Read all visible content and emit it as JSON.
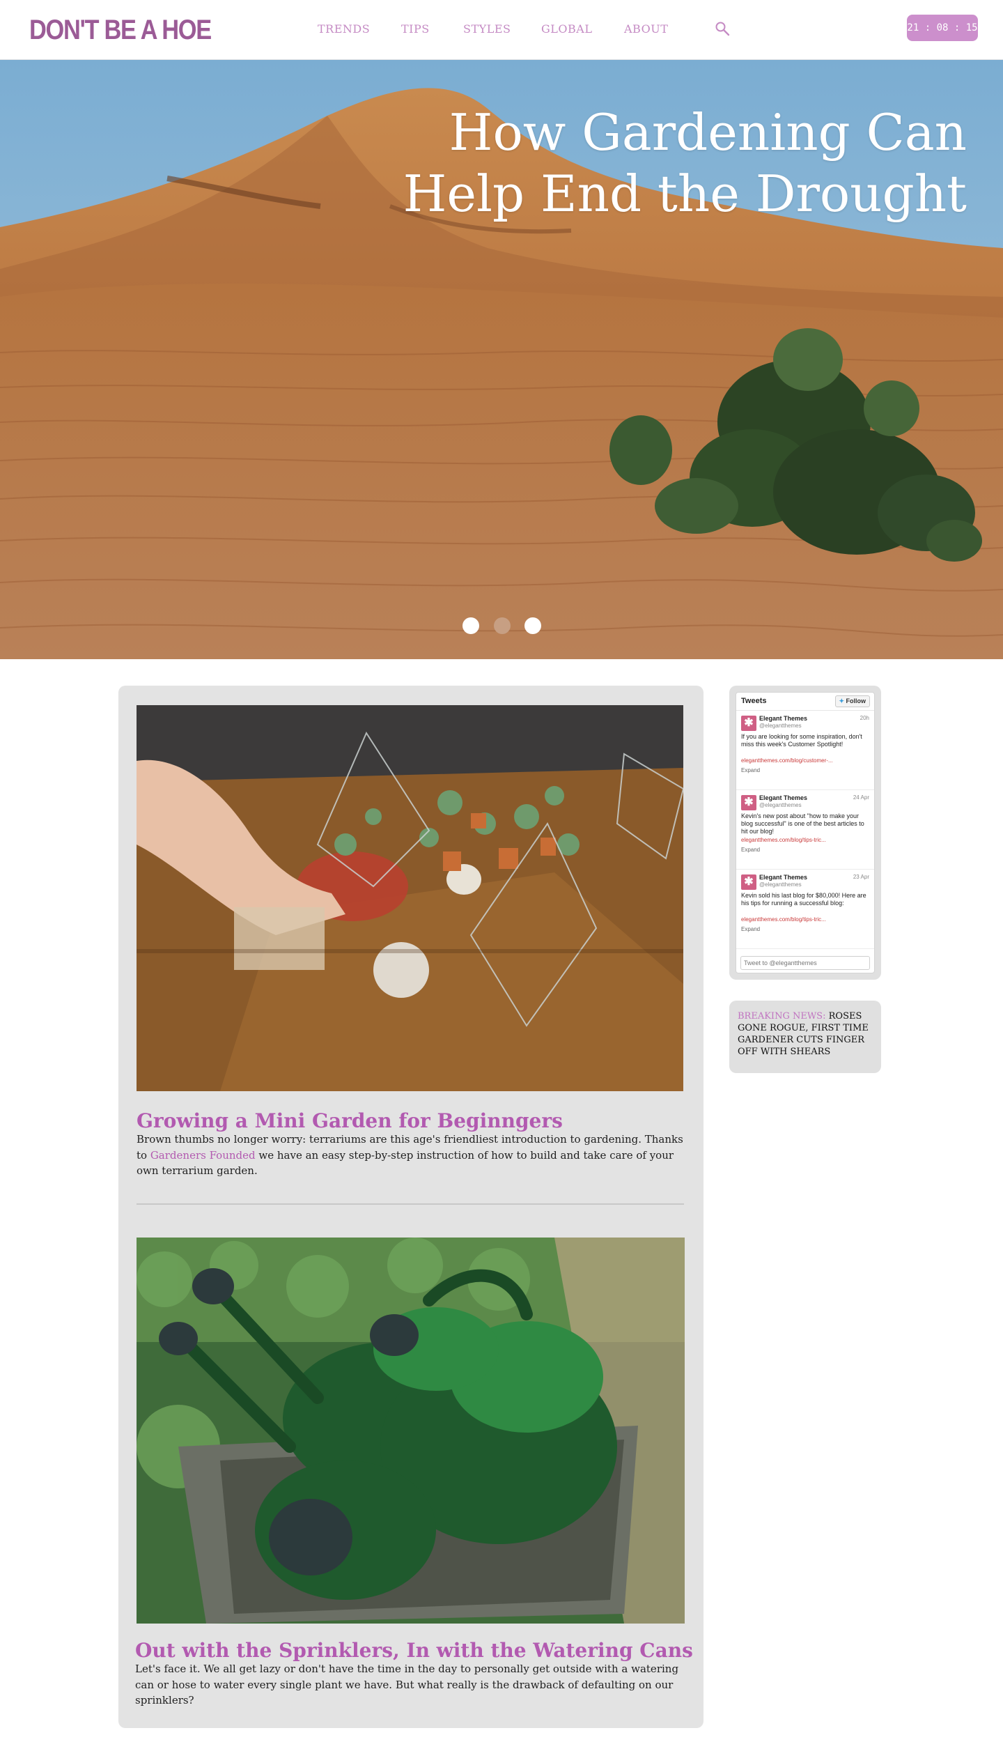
{
  "header": {
    "logo": "DON'T BE A HOE",
    "nav": [
      "TRENDS",
      "TIPS",
      "STYLES",
      "GLOBAL",
      "ABOUT"
    ],
    "clock": "21 : 08 : 15"
  },
  "hero": {
    "title_line1": "How Gardening Can",
    "title_line2": "Help End the Drought",
    "slides_total": 3,
    "active_slide": 2
  },
  "posts": [
    {
      "title": "Growing a Mini Garden for Beginngers",
      "excerpt_before": "Brown thumbs no longer worry: terrariums are this age's friendliest introduction to gardening. Thanks to ",
      "link_text": "Gardeners Founded",
      "excerpt_after": " we have an easy step-by-step instruction of how to build and take care of your own terrarium garden."
    },
    {
      "title": "Out with the Sprinklers, In with the Watering Cans",
      "excerpt": "Let's face it. We all get lazy or don't have the time in the day to personally get outside with a watering can or hose to water every single plant we have. But what really is the drawback of defaulting on our sprinklers?"
    }
  ],
  "sidebar": {
    "tweets": {
      "title": "Tweets",
      "follow_label": "Follow",
      "items": [
        {
          "name": "Elegant Themes",
          "handle": "@elegantthemes",
          "time": "20h",
          "text": "If you are looking for some inspiration, don't miss this week's Customer Spotlight!",
          "link": "elegantthemes.com/blog/customer-...",
          "expand": "Expand"
        },
        {
          "name": "Elegant Themes",
          "handle": "@elegantthemes",
          "time": "24 Apr",
          "text": "Kevin's new post about \"how to make your blog successful\" is one of the best articles to hit our blog!",
          "link": "elegantthemes.com/blog/tips-tric...",
          "expand": "Expand"
        },
        {
          "name": "Elegant Themes",
          "handle": "@elegantthemes",
          "time": "23 Apr",
          "text": "Kevin sold his last blog for $80,000! Here are his tips for running a successful blog:",
          "link": "elegantthemes.com/blog/tips-tric...",
          "expand": "Expand"
        }
      ],
      "tweet_placeholder": "Tweet to @elegantthemes"
    },
    "breaking": {
      "label": "BREAKING NEWS:",
      "text": " ROSES GONE ROGUE, FIRST TIME GARDENER CUTS FINGER OFF WITH SHEARS"
    }
  },
  "colors": {
    "brand": "#9b5b96",
    "nav": "#c58bc4",
    "accent": "#b25ab0",
    "clock_bg": "#cc8fcc"
  },
  "icons": [
    "search-icon",
    "twitter-bird-icon",
    "elegant-themes-avatar-icon"
  ]
}
